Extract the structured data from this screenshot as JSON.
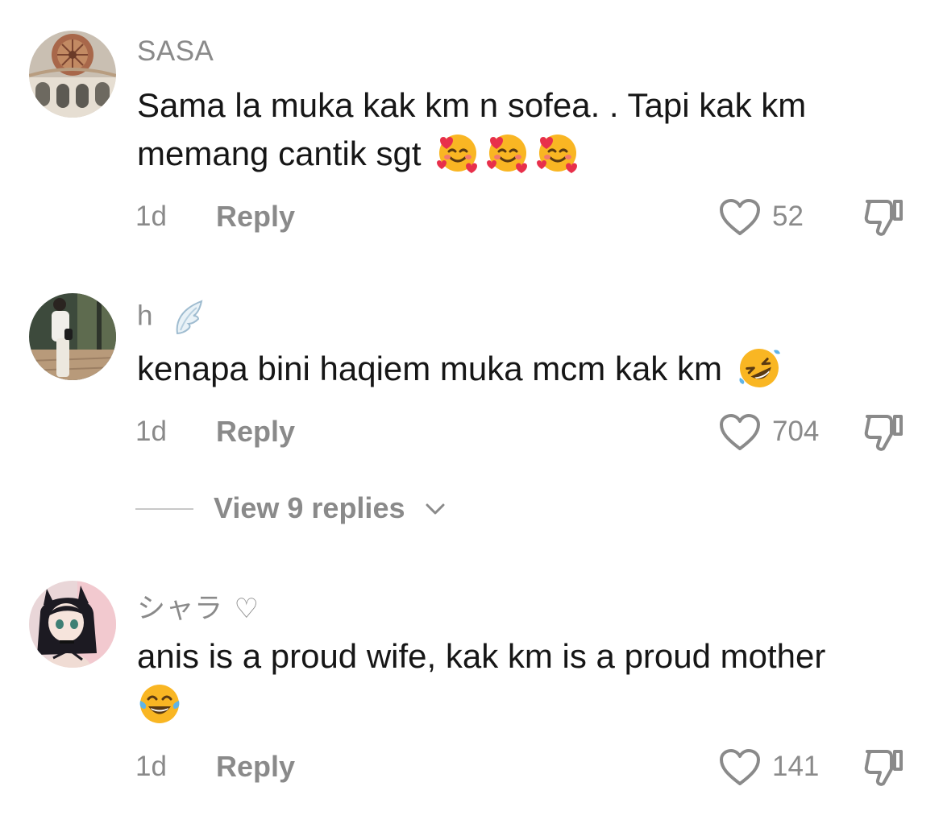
{
  "comments": [
    {
      "avatar_icon": "dome-ceiling-avatar",
      "username": "SASA",
      "username_suffix": "",
      "text_line1": "Sama la muka kak km n sofea. . Tapi kak km",
      "text_line2": "memang cantik sgt",
      "emojis": [
        "smiling-face-with-hearts",
        "smiling-face-with-hearts",
        "smiling-face-with-hearts"
      ],
      "time": "1d",
      "reply_label": "Reply",
      "likes": "52"
    },
    {
      "avatar_icon": "person-standing-avatar",
      "username": "h",
      "username_suffix": "",
      "username_emoji": "wing",
      "text_line1": "kenapa bini haqiem muka mcm kak km",
      "text_line2": "",
      "emojis": [
        "rolling-on-floor-laughing"
      ],
      "time": "1d",
      "reply_label": "Reply",
      "likes": "704"
    },
    {
      "avatar_icon": "anime-girl-avatar",
      "username": "シャラ",
      "username_suffix": "♡",
      "text_line1": "anis is a proud wife, kak km is a proud mother",
      "text_line2": "",
      "emojis": [
        "face-with-tears-of-joy"
      ],
      "time": "1d",
      "reply_label": "Reply",
      "likes": "141"
    }
  ],
  "view_replies": {
    "label": "View 9 replies"
  },
  "colors": {
    "text": "#161616",
    "secondary": "#8a8a8a",
    "divider": "#c8c8c8",
    "emoji_yellow": "#f9b623"
  }
}
